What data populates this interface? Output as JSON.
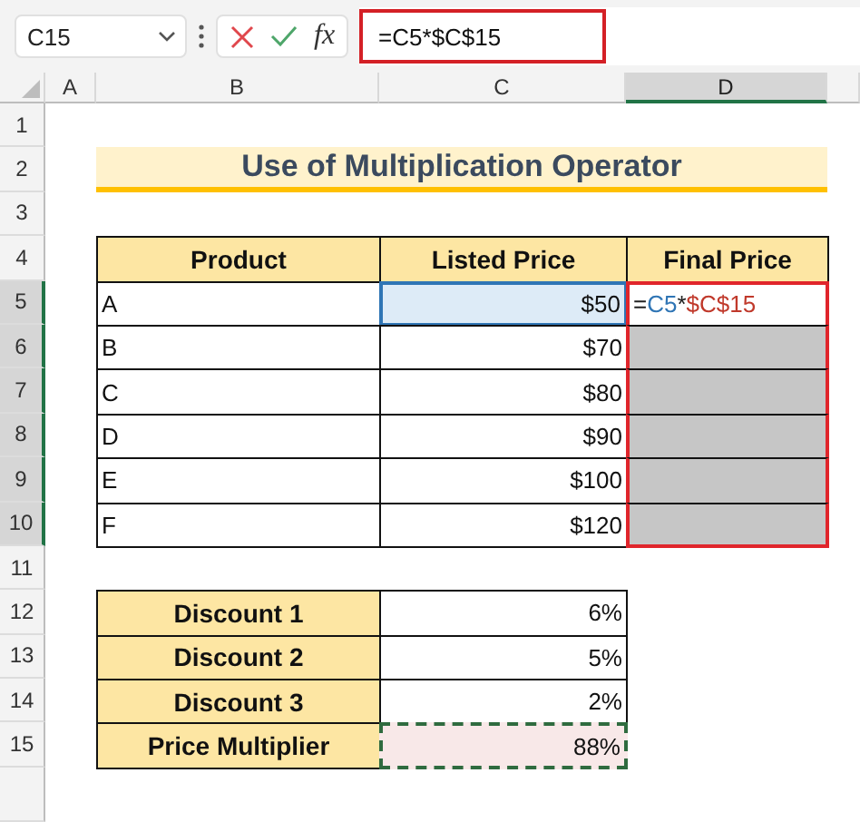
{
  "formula_bar": {
    "name_box": "C15",
    "function_button": "fx",
    "formula": "=C5*$C$15"
  },
  "columns": [
    {
      "label": "A",
      "selected": false
    },
    {
      "label": "B",
      "selected": false
    },
    {
      "label": "C",
      "selected": false
    },
    {
      "label": "D",
      "selected": true
    }
  ],
  "rows": [
    {
      "label": "1",
      "selected": false
    },
    {
      "label": "2",
      "selected": false
    },
    {
      "label": "3",
      "selected": false
    },
    {
      "label": "4",
      "selected": false
    },
    {
      "label": "5",
      "selected": true
    },
    {
      "label": "6",
      "selected": true
    },
    {
      "label": "7",
      "selected": true
    },
    {
      "label": "8",
      "selected": true
    },
    {
      "label": "9",
      "selected": true
    },
    {
      "label": "10",
      "selected": true
    },
    {
      "label": "11",
      "selected": false
    },
    {
      "label": "12",
      "selected": false
    },
    {
      "label": "13",
      "selected": false
    },
    {
      "label": "14",
      "selected": false
    },
    {
      "label": "15",
      "selected": false
    }
  ],
  "title": "Use of Multiplication Operator",
  "product_table": {
    "headers": [
      "Product",
      "Listed Price",
      "Final Price"
    ],
    "final_price_range_outlined": true,
    "rows": [
      {
        "product": "A",
        "listed_price": "$50",
        "referenced": true,
        "shaded": false,
        "final_price": [
          {
            "text": "=",
            "color": "#222222"
          },
          {
            "text": "C5",
            "color": "#2f75b5"
          },
          {
            "text": "*",
            "color": "#222222"
          },
          {
            "text": "$C$15",
            "color": "#c0392b"
          }
        ]
      },
      {
        "product": "B",
        "listed_price": "$70",
        "referenced": false,
        "shaded": true
      },
      {
        "product": "C",
        "listed_price": "$80",
        "referenced": false,
        "shaded": true
      },
      {
        "product": "D",
        "listed_price": "$90",
        "referenced": false,
        "shaded": true
      },
      {
        "product": "E",
        "listed_price": "$100",
        "referenced": false,
        "shaded": true
      },
      {
        "product": "F",
        "listed_price": "$120",
        "referenced": false,
        "shaded": true
      }
    ]
  },
  "discount_table": {
    "rows": [
      {
        "label": "Discount 1",
        "value": "6%",
        "copied": false
      },
      {
        "label": "Discount 2",
        "value": "5%",
        "copied": false
      },
      {
        "label": "Discount 3",
        "value": "2%",
        "copied": false
      },
      {
        "label": "Price Multiplier",
        "value": "88%",
        "copied": true
      }
    ]
  }
}
